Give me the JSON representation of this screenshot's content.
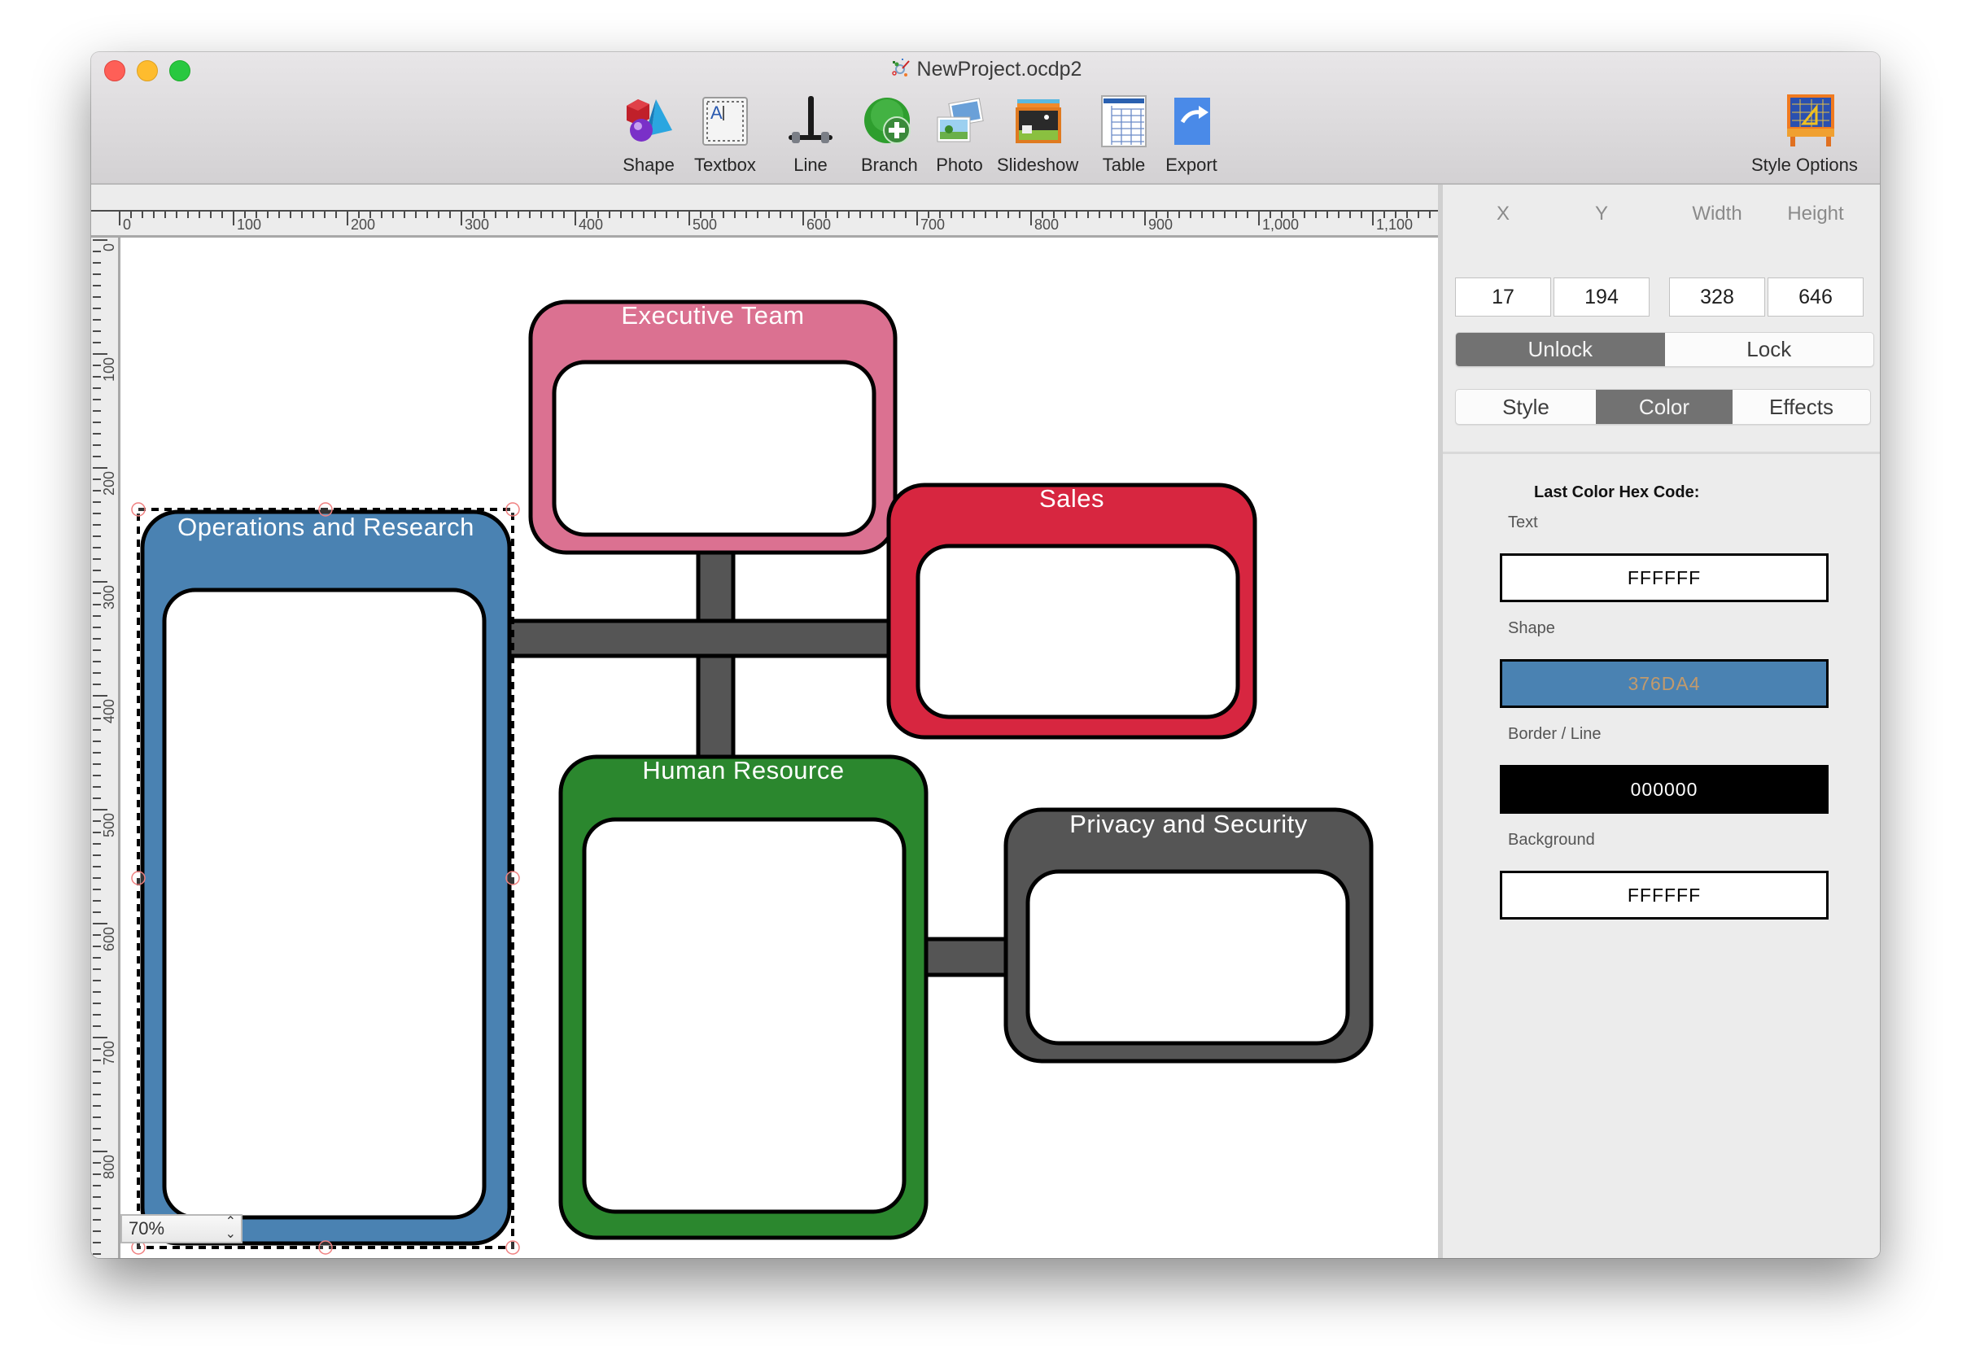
{
  "window": {
    "title": "NewProject.ocdp2",
    "title_icon": "orgchart-app-icon"
  },
  "toolbar": {
    "items": [
      {
        "label": "Shape",
        "icon": "shape-icon"
      },
      {
        "label": "Textbox",
        "icon": "textbox-icon"
      },
      {
        "label": "Line",
        "icon": "line-icon"
      },
      {
        "label": "Branch",
        "icon": "branch-add-icon"
      },
      {
        "label": "Photo",
        "icon": "photo-icon"
      },
      {
        "label": "Slideshow",
        "icon": "slideshow-icon"
      },
      {
        "label": "Table",
        "icon": "table-icon"
      },
      {
        "label": "Export",
        "icon": "export-icon"
      }
    ],
    "style_options": {
      "label": "Style Options",
      "icon": "style-options-icon"
    }
  },
  "rulers": {
    "horizontal_labels": [
      "0",
      "100",
      "200",
      "300",
      "400",
      "500",
      "600",
      "700",
      "800",
      "900",
      "1,000",
      "1,100"
    ],
    "vertical_labels": [
      "0",
      "100",
      "200",
      "300",
      "400",
      "500",
      "600",
      "700",
      "800"
    ]
  },
  "canvas": {
    "zoom": "70%",
    "shapes": [
      {
        "title": "Operations and Research",
        "fill": "#4a82b2",
        "selected": true
      },
      {
        "title": "Executive Team",
        "fill": "#db7191",
        "selected": false
      },
      {
        "title": "Sales",
        "fill": "#d72640",
        "selected": false
      },
      {
        "title": "Human Resource",
        "fill": "#2b872e",
        "selected": false
      },
      {
        "title": "Privacy and Security",
        "fill": "#555555",
        "selected": false
      }
    ],
    "connector_color": "#555555",
    "border_color": "#000000"
  },
  "inspector": {
    "geometry": {
      "x_label": "X",
      "x": "17",
      "y_label": "Y",
      "y": "194",
      "width_label": "Width",
      "width": "328",
      "height_label": "Height",
      "height": "646"
    },
    "lock_segment": {
      "unlock": "Unlock",
      "lock": "Lock",
      "active": "Unlock"
    },
    "tabs": {
      "style": "Style",
      "color": "Color",
      "effects": "Effects",
      "active": "Color"
    },
    "color": {
      "heading": "Last Color Hex Code:",
      "text_label": "Text",
      "text_value": "FFFFFF",
      "shape_label": "Shape",
      "shape_value": "376DA4",
      "border_label": "Border / Line",
      "border_value": "000000",
      "background_label": "Background",
      "background_value": "FFFFFF"
    }
  }
}
